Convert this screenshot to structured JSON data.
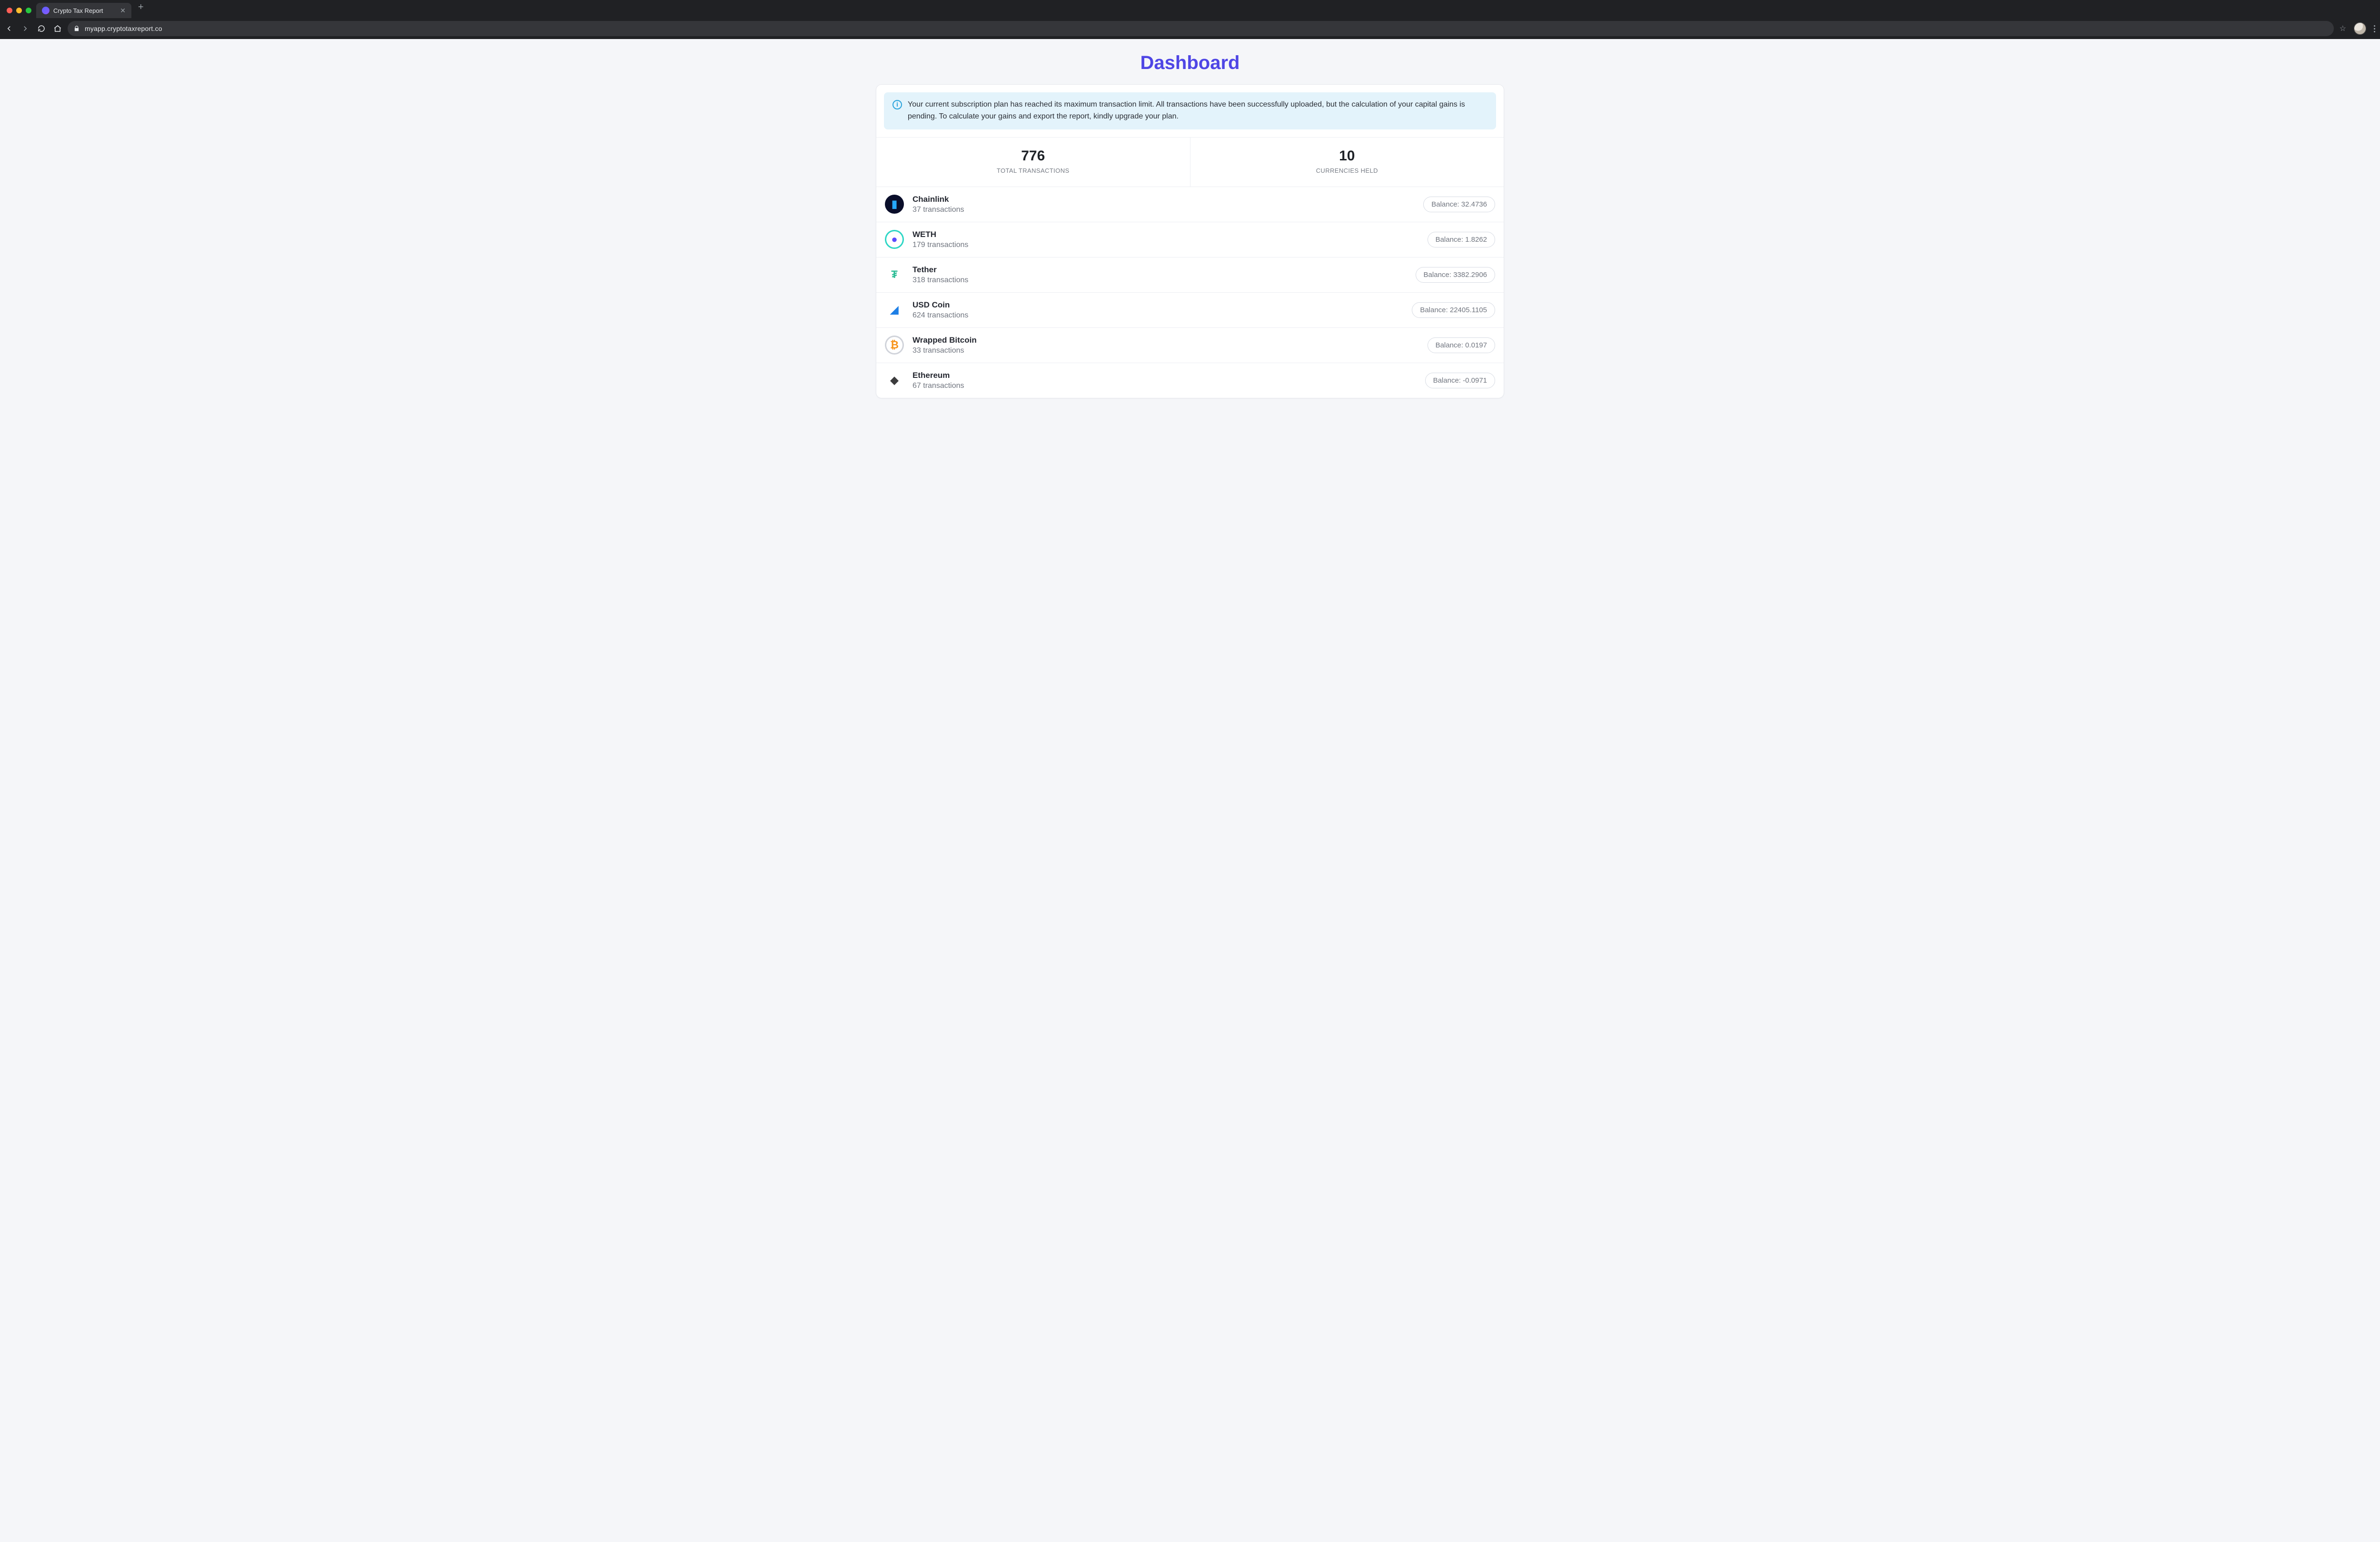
{
  "browser": {
    "tab_title": "Crypto Tax Report",
    "url": "myapp.cryptotaxreport.co"
  },
  "page": {
    "title": "Dashboard"
  },
  "alert": {
    "message": "Your current subscription plan has reached its maximum transaction limit. All transactions have been successfully uploaded, but the calculation of your capital gains is pending. To calculate your gains and export the report, kindly upgrade your plan."
  },
  "stats": {
    "total_transactions": {
      "value": "776",
      "label": "TOTAL TRANSACTIONS"
    },
    "currencies_held": {
      "value": "10",
      "label": "CURRENCIES HELD"
    }
  },
  "balance_label_prefix": "Balance: ",
  "currencies": [
    {
      "name": "Chainlink",
      "transactions": "37 transactions",
      "balance": "32.4736",
      "icon_bg": "#0a0e2a",
      "glyph": "▮",
      "glyph_color": "#26a8ff",
      "ring": null
    },
    {
      "name": "WETH",
      "transactions": "179 transactions",
      "balance": "1.8262",
      "icon_bg": "#ffffff",
      "glyph": "●",
      "glyph_color": "#5b4bff",
      "ring": "#2dd6c5"
    },
    {
      "name": "Tether",
      "transactions": "318 transactions",
      "balance": "3382.2906",
      "icon_bg": "#ffffff",
      "glyph": "₮",
      "glyph_color": "#2dbd96",
      "ring": null
    },
    {
      "name": "USD Coin",
      "transactions": "624 transactions",
      "balance": "22405.1105",
      "icon_bg": "#ffffff",
      "glyph": "◢",
      "glyph_color": "#1e7fe6",
      "ring": null
    },
    {
      "name": "Wrapped Bitcoin",
      "transactions": "33 transactions",
      "balance": "0.0197",
      "icon_bg": "#ffffff",
      "glyph": "₿",
      "glyph_color": "#f7931a",
      "ring": "#d0d3da"
    },
    {
      "name": "Ethereum",
      "transactions": "67 transactions",
      "balance": "-0.0971",
      "icon_bg": "#ffffff",
      "glyph": "◆",
      "glyph_color": "#3c3c3d",
      "ring": null
    }
  ]
}
